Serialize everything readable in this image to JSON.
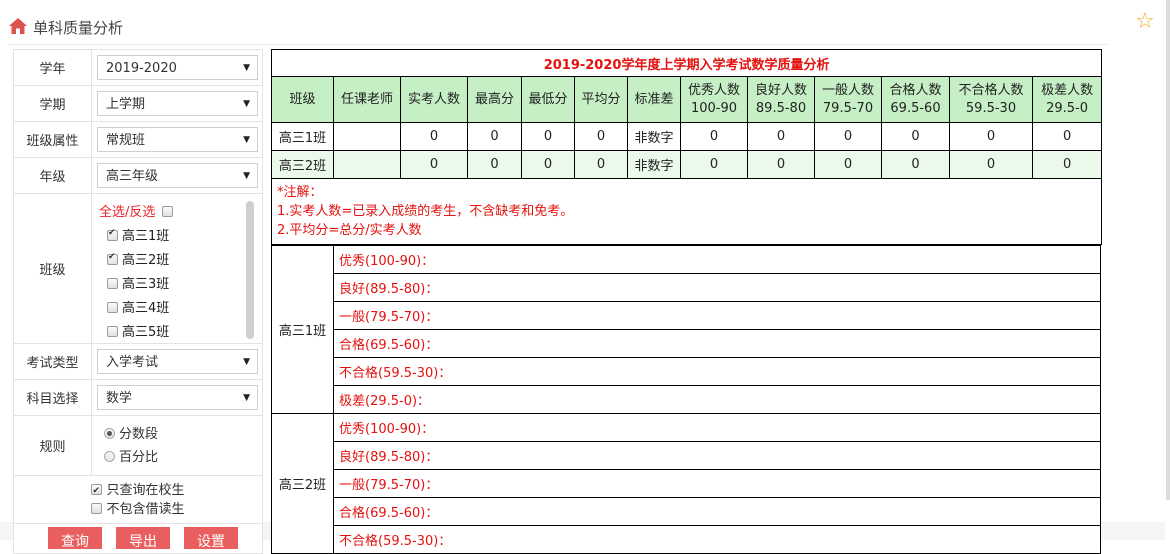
{
  "page": {
    "title": "单科质量分析",
    "accent_color": "#e4120f",
    "header_bg": "#c6efc6",
    "button_color": "#e95e5e"
  },
  "filters": {
    "year": {
      "label": "学年",
      "value": "2019-2020"
    },
    "term": {
      "label": "学期",
      "value": "上学期"
    },
    "class_type": {
      "label": "班级属性",
      "value": "常规班"
    },
    "grade": {
      "label": "年级",
      "value": "高三年级"
    },
    "classes": {
      "label": "班级",
      "select_all": "全选/反选",
      "select_all_checked": false,
      "items": [
        {
          "label": "高三1班",
          "checked": true
        },
        {
          "label": "高三2班",
          "checked": true
        },
        {
          "label": "高三3班",
          "checked": false
        },
        {
          "label": "高三4班",
          "checked": false
        },
        {
          "label": "高三5班",
          "checked": false
        }
      ]
    },
    "exam_type": {
      "label": "考试类型",
      "value": "入学考试"
    },
    "subject": {
      "label": "科目选择",
      "value": "数学"
    },
    "rule": {
      "label": "规则",
      "options": [
        {
          "label": "分数段",
          "checked": true
        },
        {
          "label": "百分比",
          "checked": false
        }
      ]
    },
    "only_enrolled": {
      "label": "只查询在校生",
      "checked": true
    },
    "exclude_borrowed": {
      "label": "不包含借读生",
      "checked": false
    },
    "buttons": [
      "查询",
      "导出",
      "设置"
    ]
  },
  "report": {
    "caption": "2019-2020学年度上学期入学考试数学质量分析",
    "headers": [
      [
        "班级"
      ],
      [
        "任课老师"
      ],
      [
        "实考人数"
      ],
      [
        "最高分"
      ],
      [
        "最低分"
      ],
      [
        "平均分"
      ],
      [
        "标准差"
      ],
      [
        "优秀人数",
        "100-90"
      ],
      [
        "良好人数",
        "89.5-80"
      ],
      [
        "一般人数",
        "79.5-70"
      ],
      [
        "合格人数",
        "69.5-60"
      ],
      [
        "不合格人数",
        "59.5-30"
      ],
      [
        "极差人数",
        "29.5-0"
      ]
    ],
    "rows": [
      [
        "高三1班",
        "",
        "0",
        "0",
        "0",
        "0",
        "非数字",
        "0",
        "0",
        "0",
        "0",
        "0",
        "0"
      ],
      [
        "高三2班",
        "",
        "0",
        "0",
        "0",
        "0",
        "非数字",
        "0",
        "0",
        "0",
        "0",
        "0",
        "0"
      ]
    ],
    "notes": [
      "*注解：",
      "1.实考人数=已录入成绩的考生，不含缺考和免考。",
      "2.平均分=总分/实考人数"
    ],
    "details": [
      {
        "class": "高三1班",
        "levels": [
          "优秀(100-90)：",
          "良好(89.5-80)：",
          "一般(79.5-70)：",
          "合格(69.5-60)：",
          "不合格(59.5-30)：",
          "极差(29.5-0)："
        ]
      },
      {
        "class": "高三2班",
        "levels": [
          "优秀(100-90)：",
          "良好(89.5-80)：",
          "一般(79.5-70)：",
          "合格(69.5-60)：",
          "不合格(59.5-30)："
        ]
      }
    ]
  }
}
